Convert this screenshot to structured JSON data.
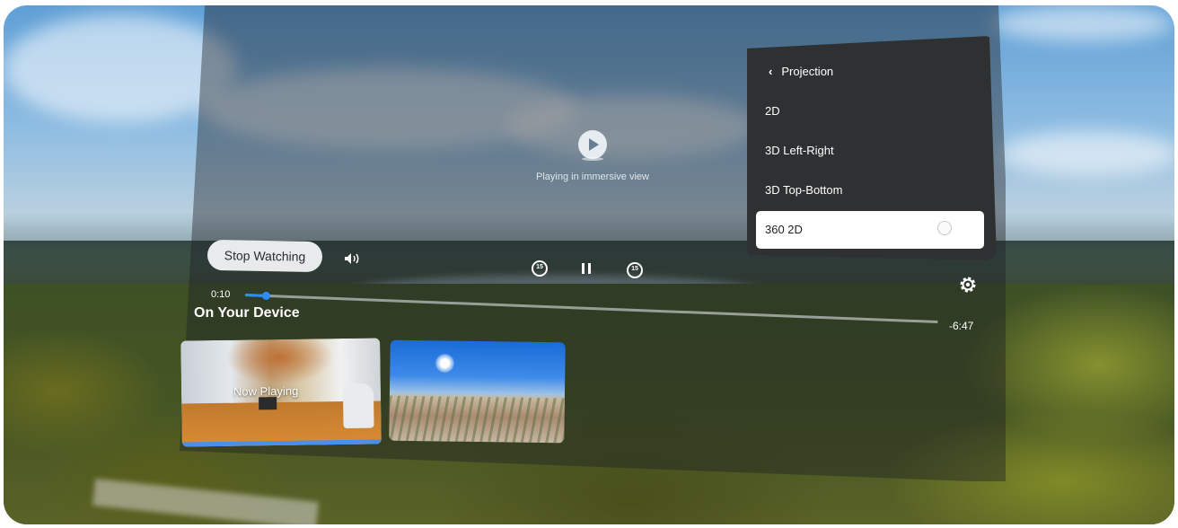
{
  "player": {
    "center_message": "Playing in immersive view",
    "stop_button_label": "Stop Watching",
    "current_time": "0:10",
    "remaining_time": "-6:47",
    "progress_fraction": 0.03
  },
  "library": {
    "section_title": "On Your Device",
    "thumbnails": [
      {
        "overlay_label": "Now Playing"
      },
      {
        "overlay_label": ""
      }
    ]
  },
  "projection_menu": {
    "header_label": "Projection",
    "items": [
      {
        "label": "2D"
      },
      {
        "label": "3D Left-Right"
      },
      {
        "label": "3D Top-Bottom"
      },
      {
        "label": "360 2D",
        "selected": true
      }
    ]
  },
  "icons": [
    "play-icon",
    "volume-icon",
    "rewind-15-icon",
    "pause-icon",
    "forward-15-icon",
    "gear-icon",
    "chevron-left-icon"
  ],
  "colors": {
    "accent": "#2a8cff",
    "menu_bg": "#2f3032"
  }
}
